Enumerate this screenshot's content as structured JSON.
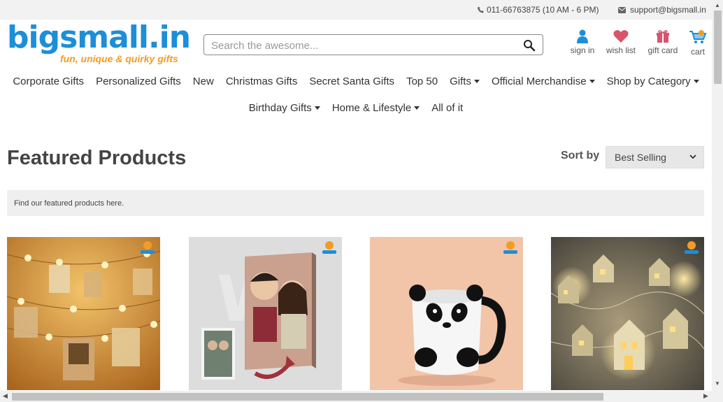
{
  "topbar": {
    "phone": "011-66763875 (10 AM - 6 PM)",
    "email": "support@bigsmall.in"
  },
  "logo": {
    "name": "bigsmall.in",
    "tagline": "fun, unique & quirky gifts"
  },
  "search": {
    "placeholder": "Search the awesome...",
    "value": ""
  },
  "user_icons": [
    {
      "label": "sign in",
      "icon": "user-icon",
      "color": "#1d8ed8"
    },
    {
      "label": "wish list",
      "icon": "heart-icon",
      "color": "#d9536b"
    },
    {
      "label": "gift card",
      "icon": "gift-icon",
      "color": "#d9536b"
    },
    {
      "label": "cart",
      "icon": "cart-icon",
      "color": "#1d8ed8"
    }
  ],
  "nav": {
    "row1": [
      {
        "label": "Corporate Gifts",
        "dropdown": false
      },
      {
        "label": "Personalized Gifts",
        "dropdown": false
      },
      {
        "label": "New",
        "dropdown": false
      },
      {
        "label": "Christmas Gifts",
        "dropdown": false
      },
      {
        "label": "Secret Santa Gifts",
        "dropdown": false
      },
      {
        "label": "Top 50",
        "dropdown": false
      },
      {
        "label": "Gifts",
        "dropdown": true
      },
      {
        "label": "Official Merchandise",
        "dropdown": true
      },
      {
        "label": "Shop by Category",
        "dropdown": true
      }
    ],
    "row2": [
      {
        "label": "Birthday Gifts",
        "dropdown": true
      },
      {
        "label": "Home & Lifestyle",
        "dropdown": true
      },
      {
        "label": "All of it",
        "dropdown": false
      }
    ]
  },
  "main": {
    "title": "Featured Products",
    "sort_label": "Sort by",
    "sort_value": "Best Selling",
    "description": "Find our featured products here."
  },
  "products": [
    {
      "name": "photo-clip-string-lights-image",
      "bg": "#c98a2e"
    },
    {
      "name": "personalized-caricature-frame-image",
      "bg": "#dcdcdc"
    },
    {
      "name": "panda-mug-image",
      "bg": "#f1c2a6"
    },
    {
      "name": "house-string-lights-image",
      "bg": "#5e5a52"
    }
  ],
  "colors": {
    "brand_blue": "#1d8ed8",
    "brand_orange": "#f39c24",
    "accent_pink": "#d9536b"
  }
}
